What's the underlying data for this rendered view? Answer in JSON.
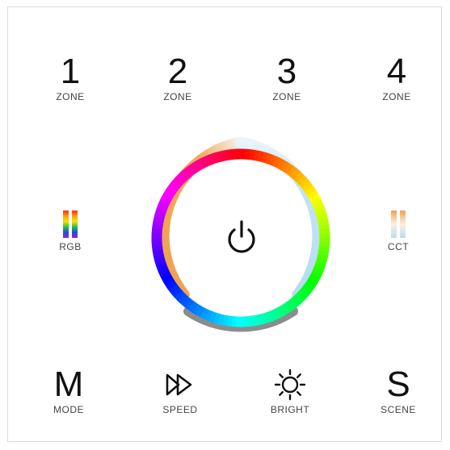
{
  "zones": [
    {
      "number": "1",
      "label": "ZONE"
    },
    {
      "number": "2",
      "label": "ZONE"
    },
    {
      "number": "3",
      "label": "ZONE"
    },
    {
      "number": "4",
      "label": "ZONE"
    }
  ],
  "left_button": {
    "label": "RGB",
    "icon": "rgb-bars-icon"
  },
  "right_button": {
    "label": "CCT",
    "icon": "cct-bars-icon"
  },
  "center": {
    "icon": "power-icon"
  },
  "bottom": {
    "mode": {
      "glyph": "M",
      "label": "MODE"
    },
    "speed": {
      "label": "SPEED",
      "icon": "fast-forward-icon"
    },
    "bright": {
      "label": "BRIGHT",
      "icon": "sun-icon"
    },
    "scene": {
      "glyph": "S",
      "label": "SCENE"
    }
  },
  "colors": {
    "warm_white": "#f0a04b",
    "cool_white": "#b9dff3",
    "gray_segment": "#8c8c8c"
  }
}
